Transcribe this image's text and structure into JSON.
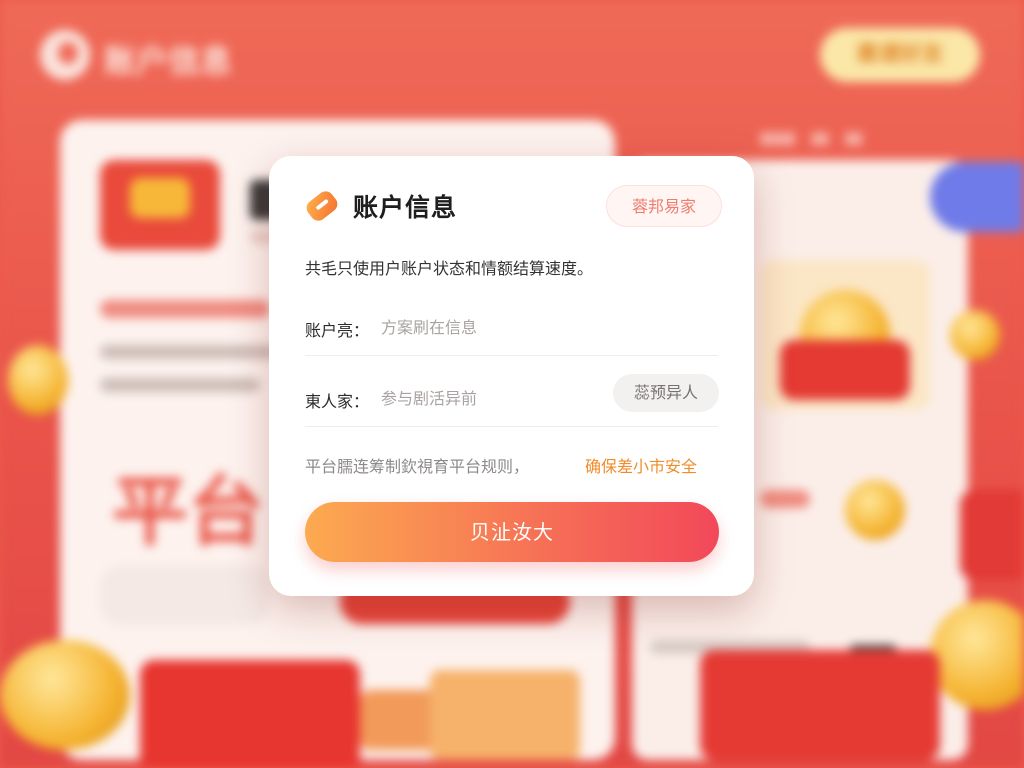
{
  "background": {
    "app_title": "账户信息",
    "header_button": "邀请好友",
    "big_banner_text": "平台",
    "colors": {
      "page_red": "#e9534a",
      "card": "#fdf2ee",
      "coin_gold": "#f5b330",
      "pill_yellow": "#fbe7a8",
      "accent_blue": "#6f7be8"
    },
    "icons": [
      "brand-logo-icon",
      "gold-coin-icon",
      "red-envelope-icon"
    ]
  },
  "dialog": {
    "title": "账户信息",
    "tag": "蓉邦易家",
    "description": "共毛只使用户账户状态和情额结算速度。",
    "fields": [
      {
        "label": "账户亮：",
        "placeholder": "方案刷在信息",
        "value": ""
      },
      {
        "label": "東人家：",
        "placeholder": "参与剧活异前",
        "value": "",
        "side_button": "蕊预异人"
      }
    ],
    "notice": "平台臑连筹制欽視育平台规则，",
    "notice_link": "确保差小市安全",
    "submit_label": "贝沚汝大",
    "colors": {
      "accent_orange": "#f08c2a",
      "gradient_start": "#fcaa50",
      "gradient_end": "#f2485a",
      "tag_text": "#ee7d70"
    },
    "icons": [
      "brand-logo-icon"
    ]
  }
}
